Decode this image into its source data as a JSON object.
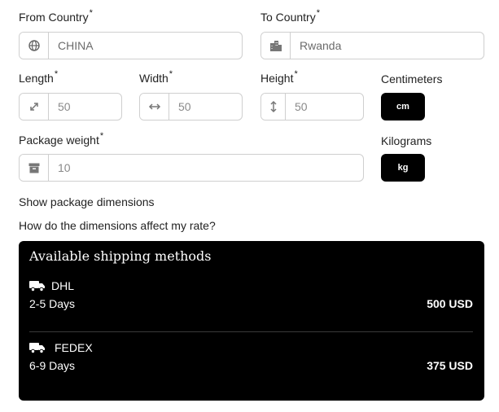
{
  "form": {
    "from_country": {
      "label": "From Country",
      "required_mark": "*",
      "value": "CHINA",
      "icon": "globe-icon"
    },
    "to_country": {
      "label": "To Country",
      "required_mark": "*",
      "value": "Rwanda",
      "icon": "city-icon"
    },
    "length": {
      "label": "Length",
      "required_mark": "*",
      "value": "50",
      "icon": "diagonal-resize-icon"
    },
    "width": {
      "label": "Width",
      "required_mark": "*",
      "value": "50",
      "icon": "horizontal-arrows-icon"
    },
    "height": {
      "label": "Height",
      "required_mark": "*",
      "value": "50",
      "icon": "vertical-arrows-icon"
    },
    "dimension_unit": {
      "label": "Centimeters",
      "button": "cm"
    },
    "package_weight": {
      "label": "Package weight",
      "required_mark": "*",
      "value": "10",
      "icon": "archive-box-icon"
    },
    "weight_unit": {
      "label": "Kilograms",
      "button": "kg"
    }
  },
  "links": {
    "show_dimensions": "Show package dimensions",
    "rate_help": "How do the dimensions affect my rate?"
  },
  "shipping": {
    "title": "Available shipping methods",
    "methods": [
      {
        "carrier": "DHL",
        "duration": "2-5 Days",
        "price": "500 USD",
        "icon": "truck-icon"
      },
      {
        "carrier": "FEDEX",
        "duration": "6-9 Days",
        "price": "375 USD",
        "icon": "truck-icon"
      }
    ]
  },
  "colors": {
    "panel_bg": "#000000",
    "border": "#cfcfcf",
    "text": "#222222"
  }
}
